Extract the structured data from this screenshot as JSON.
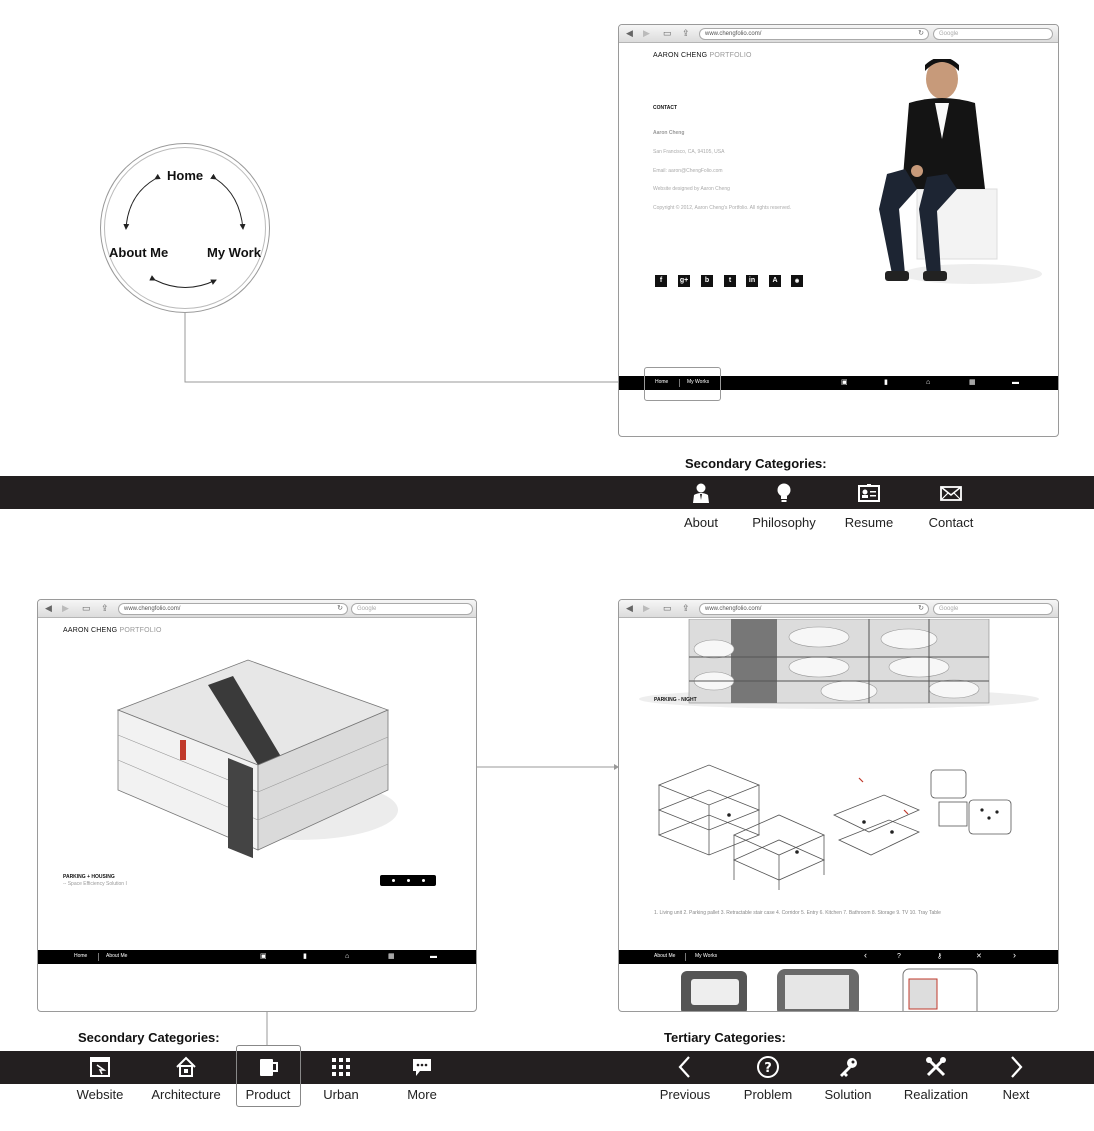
{
  "diagram": {
    "home": "Home",
    "about": "About Me",
    "work": "My Work"
  },
  "browser_common": {
    "url": "www.chengfolio.com/",
    "search_placeholder": "Google"
  },
  "brand": {
    "name": "AARON CHENG",
    "suffix": "PORTFOLIO"
  },
  "contact_page": {
    "heading": "CONTACT",
    "name": "Aaron Cheng",
    "lines": [
      "San Francisco, CA, 94105, USA",
      "Email: aaron@ChengFolio.com",
      "Website designed by Aaron Cheng",
      "Copyright © 2012, Aaron Cheng's Portfolio. All rights reserved."
    ],
    "social_icons": [
      "facebook-icon",
      "google-plus-icon",
      "blogger-icon",
      "tumblr-icon",
      "linkedin-icon",
      "acrobat-icon",
      "issuu-icon"
    ],
    "nav": {
      "home": "Home",
      "works": "My Works"
    }
  },
  "secondary_top": {
    "title": "Secondary Categories:",
    "items": [
      {
        "label": "About",
        "icon": "person-icon"
      },
      {
        "label": "Philosophy",
        "icon": "lightbulb-icon"
      },
      {
        "label": "Resume",
        "icon": "id-card-icon"
      },
      {
        "label": "Contact",
        "icon": "envelope-icon"
      }
    ]
  },
  "product_page": {
    "project_title": "PARKING + HOUSING",
    "project_subtitle": "-- Space Efficiency Solution I",
    "nav": {
      "home": "Home",
      "about": "About Me"
    }
  },
  "detail_page": {
    "caption": "PARKING - NIGHT",
    "legend": "1. Living unit    2. Parking pallet    3. Retractable stair case    4. Corridor    5. Entry    6. Kitchen    7. Bathroom    8. Storage    9. TV    10. Tray Table",
    "nav": {
      "about": "About Me",
      "works": "My Works"
    }
  },
  "secondary_bottom": {
    "title": "Secondary Categories:",
    "items": [
      {
        "label": "Website",
        "icon": "website-icon"
      },
      {
        "label": "Architecture",
        "icon": "house-icon"
      },
      {
        "label": "Product",
        "icon": "mug-icon"
      },
      {
        "label": "Urban",
        "icon": "grid-icon"
      },
      {
        "label": "More",
        "icon": "speech-bubble-icon"
      }
    ],
    "selected": "Product"
  },
  "tertiary": {
    "title": "Tertiary Categories:",
    "items": [
      {
        "label": "Previous",
        "icon": "chevron-left-icon"
      },
      {
        "label": "Problem",
        "icon": "question-icon"
      },
      {
        "label": "Solution",
        "icon": "key-icon"
      },
      {
        "label": "Realization",
        "icon": "tools-icon"
      },
      {
        "label": "Next",
        "icon": "chevron-right-icon"
      }
    ]
  },
  "colors": {
    "bar": "#231f20",
    "nav_black": "#000000",
    "accent_red": "#c0392b"
  }
}
